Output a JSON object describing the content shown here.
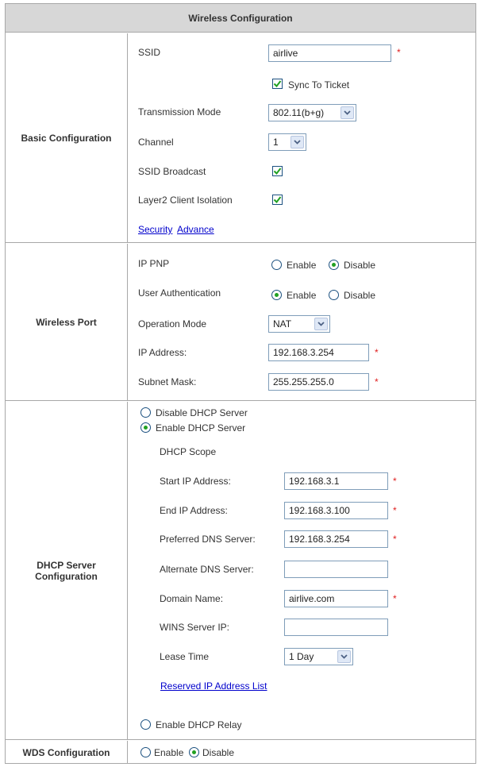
{
  "title": "Wireless Configuration",
  "basic": {
    "label": "Basic Configuration",
    "ssid_label": "SSID",
    "ssid_value": "airlive",
    "sync_label": "Sync To Ticket",
    "sync_checked": true,
    "tx_mode_label": "Transmission Mode",
    "tx_mode_value": "802.11(b+g)",
    "channel_label": "Channel",
    "channel_value": "1",
    "ssid_broadcast_label": "SSID Broadcast",
    "ssid_broadcast_checked": true,
    "isolation_label": "Layer2 Client Isolation",
    "isolation_checked": true,
    "security_link": "Security",
    "advance_link": "Advance"
  },
  "port": {
    "label": "Wireless Port",
    "ip_pnp_label": "IP PNP",
    "ip_pnp_selected": "Disable",
    "user_auth_label": "User Authentication",
    "user_auth_selected": "Enable",
    "enable_option": "Enable",
    "disable_option": "Disable",
    "op_mode_label": "Operation Mode",
    "op_mode_value": "NAT",
    "ip_label": "IP Address:",
    "ip_value": "192.168.3.254",
    "mask_label": "Subnet Mask:",
    "mask_value": "255.255.255.0"
  },
  "dhcp": {
    "label": "DHCP Server Configuration",
    "disable_server": "Disable DHCP Server",
    "enable_server": "Enable DHCP Server",
    "selected_mode": "Enable DHCP Server",
    "scope_label": "DHCP Scope",
    "start_ip_label": "Start IP Address:",
    "start_ip_value": "192.168.3.1",
    "end_ip_label": "End IP Address:",
    "end_ip_value": "192.168.3.100",
    "pref_dns_label": "Preferred DNS Server:",
    "pref_dns_value": "192.168.3.254",
    "alt_dns_label": "Alternate DNS Server:",
    "alt_dns_value": "",
    "domain_label": "Domain Name:",
    "domain_value": "airlive.com",
    "wins_label": "WINS Server IP:",
    "wins_value": "",
    "lease_label": "Lease Time",
    "lease_value": "1 Day",
    "reserved_link": "Reserved IP Address List",
    "relay_label": "Enable DHCP Relay"
  },
  "wds": {
    "label": "WDS Configuration",
    "enable_option": "Enable",
    "disable_option": "Disable",
    "selected": "Disable"
  },
  "required_mark": "*",
  "colors": {
    "border": "#a8a8a8",
    "header_bg": "#d7d7d7",
    "link": "#0000cc",
    "required": "#e02020",
    "radio_dot": "#21a121"
  }
}
